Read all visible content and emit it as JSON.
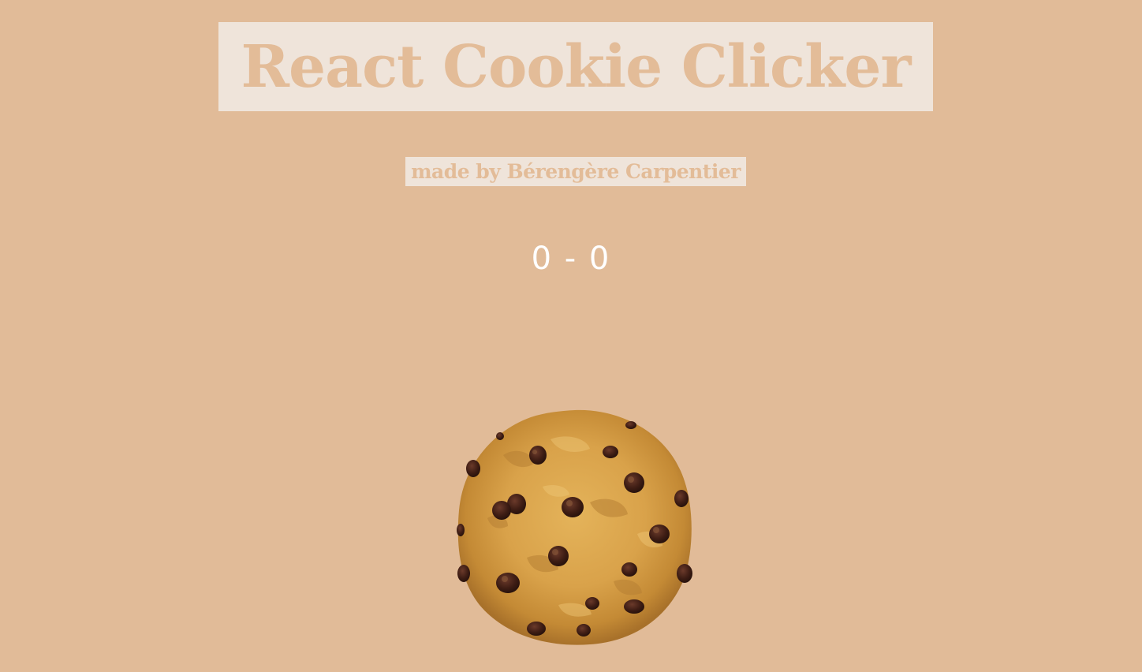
{
  "header": {
    "title": "React Cookie Clicker",
    "subtitle": "made by Bérengère Carpentier"
  },
  "score": {
    "text": "0 - 0"
  },
  "cookie": {
    "icon": "cookie-icon"
  },
  "colors": {
    "background": "#e1bb98",
    "banner": "#efe4da",
    "title_text": "#e3bc98",
    "score_text": "#ffffff"
  }
}
